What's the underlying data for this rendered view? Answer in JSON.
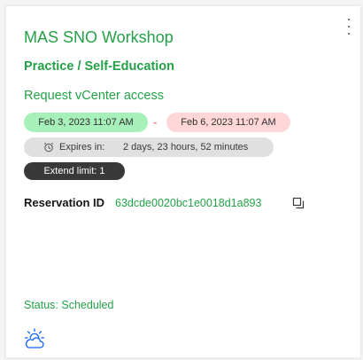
{
  "card": {
    "title": "MAS SNO Workshop",
    "subtitle": "Practice / Self-Education",
    "request_link": "Request vCenter access",
    "menu_icon": "overflow-menu-vertical-icon",
    "start_date": "Feb 3, 2023 11:07 AM",
    "date_separator": "-",
    "end_date": "Feb 6, 2023 11:07 AM",
    "expires_label": "Expires in:",
    "expires_value": "2 days, 23 hours, 52 minutes",
    "expires_icon": "alarm-clock-icon",
    "extend_limit": "Extend limit: 1",
    "reservation_label": "Reservation ID",
    "reservation_id": "63dcde0020bc1e0018d1a893",
    "copy_icon": "copy-icon",
    "status": "Status: Scheduled",
    "footer_icon": "partly-cloudy-icon"
  },
  "colors": {
    "accent_green": "#24a148",
    "start_pill": "#a7f0ba",
    "end_pill": "#ffd7d9",
    "expires_pill": "#e0e0e0",
    "extend_pill": "#393939",
    "icon_blue": "#0f62fe"
  }
}
